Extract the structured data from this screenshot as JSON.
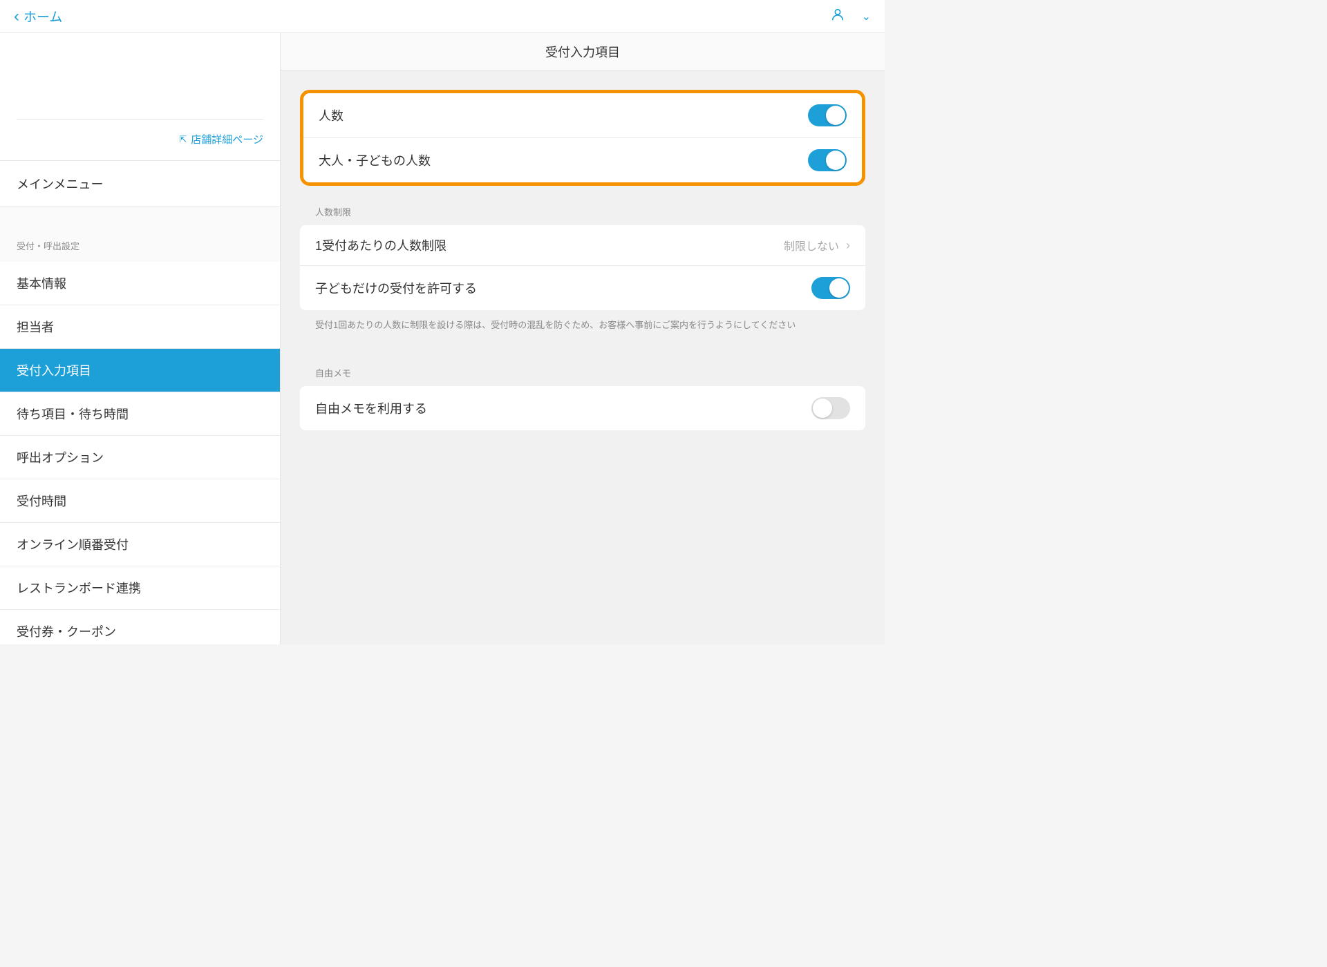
{
  "header": {
    "back_label": "ホーム"
  },
  "sidebar": {
    "store_link": "店舗詳細ページ",
    "main_menu": "メインメニュー",
    "section_label": "受付・呼出設定",
    "items": [
      "基本情報",
      "担当者",
      "受付入力項目",
      "待ち項目・待ち時間",
      "呼出オプション",
      "受付時間",
      "オンライン順番受付",
      "レストランボード連携",
      "受付券・クーポン"
    ]
  },
  "content": {
    "title": "受付入力項目",
    "highlight": {
      "row1_label": "人数",
      "row1_on": true,
      "row2_label": "大人・子どもの人数",
      "row2_on": true
    },
    "limits": {
      "group_label": "人数制限",
      "row1_label": "1受付あたりの人数制限",
      "row1_value": "制限しない",
      "row2_label": "子どもだけの受付を許可する",
      "row2_on": true,
      "help": "受付1回あたりの人数に制限を設ける際は、受付時の混乱を防ぐため、お客様へ事前にご案内を行うようにしてください"
    },
    "memo": {
      "group_label": "自由メモ",
      "row1_label": "自由メモを利用する",
      "row1_on": false
    }
  }
}
